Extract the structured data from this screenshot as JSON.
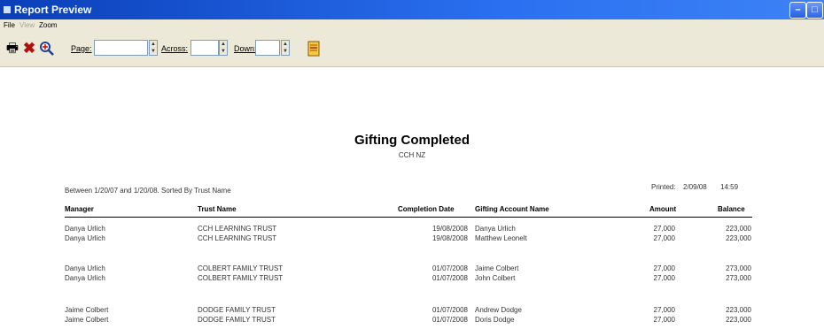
{
  "window": {
    "title": "Report Preview"
  },
  "menu": {
    "file": "File",
    "view": "View",
    "zoom": "Zoom"
  },
  "toolbar": {
    "page_label": "Page:",
    "across_label": "Across:",
    "down_label": "Down:"
  },
  "report": {
    "title": "Gifting Completed",
    "subtitle": "CCH NZ",
    "criteria": "Between 1/20/07 and 1/20/08. Sorted By Trust Name",
    "printed_label": "Printed:",
    "printed_date": "2/09/08",
    "printed_time": "14:59",
    "headers": {
      "manager": "Manager",
      "trust": "Trust Name",
      "date": "Completion Date",
      "account": "Gifting Account Name",
      "amount": "Amount",
      "balance": "Balance"
    },
    "rows": [
      {
        "manager": "Danya Urlich",
        "trust": "CCH LEARNING TRUST",
        "date": "19/08/2008",
        "account": "Danya Urlich",
        "amount": "27,000",
        "balance": "223,000"
      },
      {
        "manager": "Danya Urlich",
        "trust": "CCH LEARNING TRUST",
        "date": "19/08/2008",
        "account": "Matthew Leonelt",
        "amount": "27,000",
        "balance": "223,000"
      },
      {
        "manager": "Danya Urlich",
        "trust": "COLBERT FAMILY TRUST",
        "date": "01/07/2008",
        "account": "Jaime Colbert",
        "amount": "27,000",
        "balance": "273,000"
      },
      {
        "manager": "Danya Urlich",
        "trust": "COLBERT FAMILY TRUST",
        "date": "01/07/2008",
        "account": "John Colbert",
        "amount": "27,000",
        "balance": "273,000"
      },
      {
        "manager": "Jaime Colbert",
        "trust": "DODGE FAMILY TRUST",
        "date": "01/07/2008",
        "account": "Andrew Dodge",
        "amount": "27,000",
        "balance": "223,000"
      },
      {
        "manager": "Jaime Colbert",
        "trust": "DODGE FAMILY TRUST",
        "date": "01/07/2008",
        "account": "Doris Dodge",
        "amount": "27,000",
        "balance": "223,000"
      }
    ]
  }
}
